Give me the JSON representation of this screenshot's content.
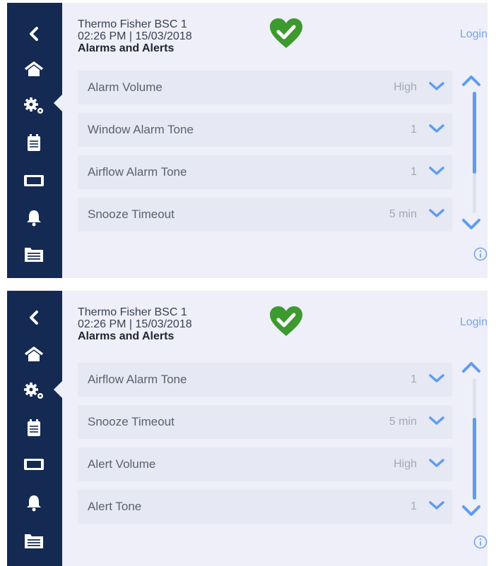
{
  "screens": [
    {
      "header": {
        "device": "Thermo Fisher BSC 1",
        "datetime": "02:26 PM | 15/03/2018",
        "page_title": "Alarms and Alerts",
        "login_label": "Login"
      },
      "rows": [
        {
          "label": "Alarm Volume",
          "value": "High"
        },
        {
          "label": "Window Alarm Tone",
          "value": "1"
        },
        {
          "label": "Airflow Alarm Tone",
          "value": "1"
        },
        {
          "label": "Snooze Timeout",
          "value": "5 min"
        }
      ],
      "scroll_position": "top"
    },
    {
      "header": {
        "device": "Thermo Fisher BSC 1",
        "datetime": "02:26 PM | 15/03/2018",
        "page_title": "Alarms and Alerts",
        "login_label": "Login"
      },
      "rows": [
        {
          "label": "Airflow Alarm Tone",
          "value": "1"
        },
        {
          "label": "Snooze Timeout",
          "value": "5 min"
        },
        {
          "label": "Alert Volume",
          "value": "High"
        },
        {
          "label": "Alert Tone",
          "value": "1"
        }
      ],
      "scroll_position": "bottom"
    }
  ],
  "sidebar": {
    "items": [
      "back-icon",
      "home-icon",
      "settings-icon",
      "clipboard-icon",
      "display-icon",
      "bell-icon",
      "log-icon"
    ],
    "active_item": "settings-icon"
  },
  "colors": {
    "sidebar": "#142a52",
    "accent": "#5e9cf0",
    "status_ok": "#3c9a2e",
    "background": "#eeeff8"
  }
}
